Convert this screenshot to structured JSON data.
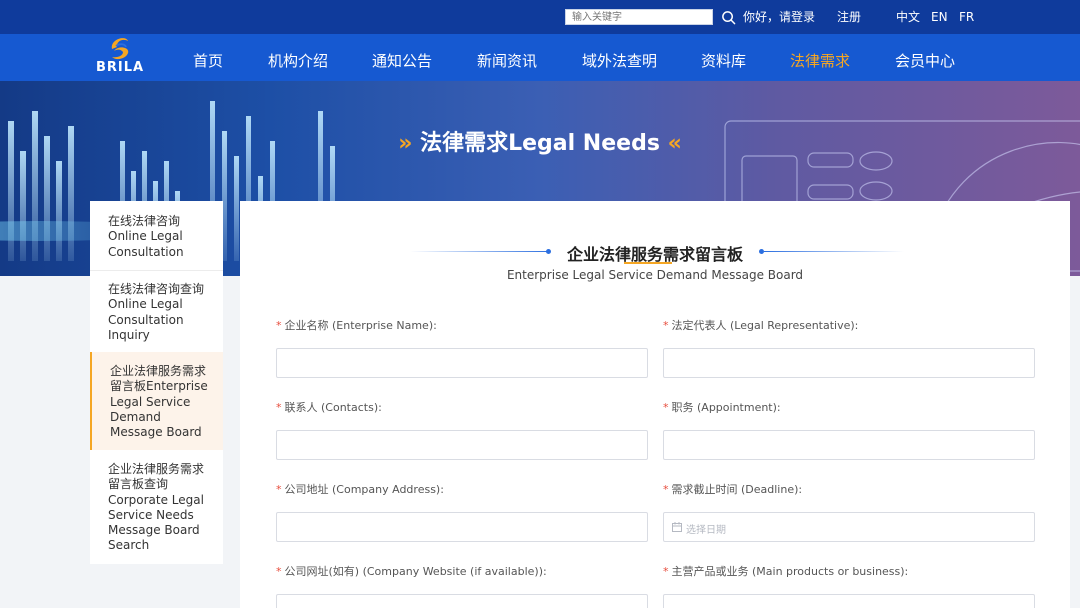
{
  "topbar": {
    "search_placeholder": "输入关键字",
    "greeting": "你好，请登录",
    "register": "注册",
    "lang_zh": "中文",
    "lang_en": "EN",
    "lang_fr": "FR"
  },
  "brand": {
    "logo_text": "BRILA"
  },
  "nav": {
    "items": [
      "首页",
      "机构介绍",
      "通知公告",
      "新闻资讯",
      "域外法查明",
      "资料库",
      "法律需求",
      "会员中心"
    ],
    "active_index": 6
  },
  "banner": {
    "title": "法律需求Legal Needs",
    "chev_left": "»",
    "chev_right": "«"
  },
  "sidebar": {
    "items": [
      {
        "lines": [
          "在线法律咨询",
          "Online Legal",
          "Consultation"
        ]
      },
      {
        "lines": [
          "在线法律咨询查询",
          "Online Legal",
          "Consultation",
          "Inquiry"
        ]
      },
      {
        "lines": [
          "企业法律服务需求",
          "留言板Enterprise",
          "Legal Service",
          "Demand",
          "Message Board"
        ]
      },
      {
        "lines": [
          "企业法律服务需求",
          "留言板查询",
          "Corporate Legal",
          "Service Needs",
          "Message Board",
          "Search"
        ]
      }
    ],
    "active_index": 2
  },
  "form": {
    "title": "企业法律服务需求留言板",
    "subtitle": "Enterprise Legal Service Demand Message Board",
    "required_mark": "*",
    "fields": {
      "enterprise_name": {
        "label": "企业名称 (Enterprise Name):",
        "value": ""
      },
      "legal_rep": {
        "label": "法定代表人 (Legal Representative):",
        "value": ""
      },
      "contacts": {
        "label": "联系人 (Contacts):",
        "value": ""
      },
      "appointment": {
        "label": "职务 (Appointment):",
        "value": ""
      },
      "company_address": {
        "label": "公司地址 (Company Address):",
        "value": ""
      },
      "deadline": {
        "label": "需求截止时间 (Deadline):",
        "placeholder": "选择日期"
      },
      "company_website": {
        "label": "公司网址(如有) (Company Website (if available)):",
        "value": ""
      },
      "main_products": {
        "label": "主营产品或业务 (Main products or business):",
        "value": ""
      }
    }
  },
  "colors": {
    "topbar": "#0f3b9c",
    "navbar": "#1659d1",
    "accent": "#f5a623",
    "required": "#e74c3c"
  },
  "icons": [
    "search-icon",
    "logo-icon",
    "calendar-icon"
  ]
}
